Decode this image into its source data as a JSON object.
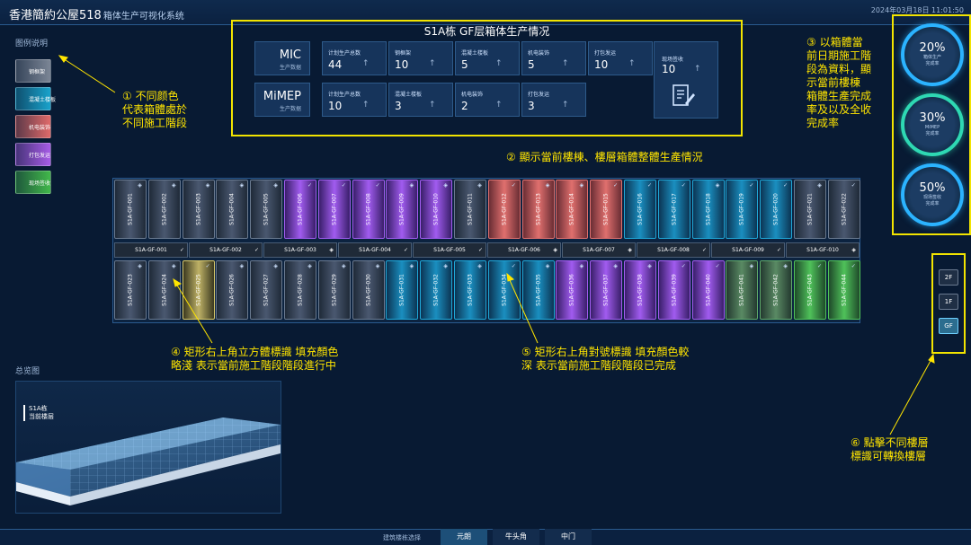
{
  "app": {
    "title": "香港簡約公屋518",
    "subtitle": "箱体生产可视化系统",
    "datetime": "2024年03月18日 11:01:50"
  },
  "legend": {
    "title": "图例说明",
    "items": [
      {
        "label": "钢框架",
        "color": "#7c8696"
      },
      {
        "label": "混凝土楼板",
        "color": "#1aa3cc"
      },
      {
        "label": "机电装饰",
        "color": "#e06a6a"
      },
      {
        "label": "打包发运",
        "color": "#a75ce6"
      },
      {
        "label": "现场签收",
        "color": "#42b84b"
      }
    ]
  },
  "panel": {
    "title": "S1A栋 GF层箱体生产情况",
    "mic": {
      "name": "MIC",
      "sub": "生产数据",
      "stats": [
        {
          "label": "计划生产总数",
          "value": "44"
        },
        {
          "label": "钢框架",
          "value": "10"
        },
        {
          "label": "混凝土楼板",
          "value": "5"
        },
        {
          "label": "机电装饰",
          "value": "5"
        },
        {
          "label": "打包发运",
          "value": "10"
        }
      ]
    },
    "mimep": {
      "name": "MiMEP",
      "sub": "生产数据",
      "stats": [
        {
          "label": "计划生产总数",
          "value": "10"
        },
        {
          "label": "混凝土楼板",
          "value": "3"
        },
        {
          "label": "机电装饰",
          "value": "2"
        },
        {
          "label": "打包发运",
          "value": "3"
        }
      ]
    },
    "signed": {
      "label": "现场签收",
      "value": "10"
    },
    "arrow": "↑"
  },
  "progress": [
    {
      "value": "20%",
      "label1": "箱体生产",
      "label2": "完成率",
      "fraction": 0.2
    },
    {
      "value": "30%",
      "label1": "MiMEP",
      "label2": "完成率",
      "fraction": 0.3
    },
    {
      "value": "50%",
      "label1": "现场签收",
      "label2": "完成率",
      "fraction": 0.5
    }
  ],
  "annotations": {
    "a1": "① 不同颜色\n代表箱體處於\n不同施工階段",
    "a2": "② 顯示當前樓棟、樓層箱體整體生產情況",
    "a3": "③ 以箱體當\n前日期施工階\n段為資料，顯\n示當前樓棟\n箱體生產完成\n率及以及全收\n完成率",
    "a4": "④ 矩形右上角立方體標識  填充顏色\n略淺  表示當前施工階段階段進行中",
    "a5": "⑤ 矩形右上角對號標識  填充顏色較\n深  表示當前施工階段階段已完成",
    "a6": "⑥ 點擊不同樓層\n標識可轉換樓層"
  },
  "top_row": [
    {
      "code": "S1A-GF-001",
      "s": "gray",
      "m": "cube"
    },
    {
      "code": "S1A-GF-002",
      "s": "gray",
      "m": "cube"
    },
    {
      "code": "S1A-GF-003",
      "s": "gray",
      "m": "cube"
    },
    {
      "code": "S1A-GF-004",
      "s": "gray",
      "m": "cube"
    },
    {
      "code": "S1A-GF-005",
      "s": "gray",
      "m": "cube"
    },
    {
      "code": "S1A-GF-006",
      "s": "purple",
      "m": "check"
    },
    {
      "code": "S1A-GF-007",
      "s": "purple",
      "m": "check"
    },
    {
      "code": "S1A-GF-008",
      "s": "purple",
      "m": "check"
    },
    {
      "code": "S1A-GF-009",
      "s": "purple",
      "m": "cube"
    },
    {
      "code": "S1A-GF-010",
      "s": "purple",
      "m": "cube"
    },
    {
      "code": "S1A-GF-011",
      "s": "gray",
      "m": "cube"
    },
    {
      "code": "S1A-GF-012",
      "s": "red",
      "m": "check"
    },
    {
      "code": "S1A-GF-013",
      "s": "red",
      "m": "cube"
    },
    {
      "code": "S1A-GF-014",
      "s": "red",
      "m": "cube"
    },
    {
      "code": "S1A-GF-015",
      "s": "red",
      "m": "check"
    },
    {
      "code": "S1A-GF-016",
      "s": "teal",
      "m": "check"
    },
    {
      "code": "S1A-GF-017",
      "s": "teal",
      "m": "check"
    },
    {
      "code": "S1A-GF-018",
      "s": "teal",
      "m": "cube"
    },
    {
      "code": "S1A-GF-019",
      "s": "teal",
      "m": "check"
    },
    {
      "code": "S1A-GF-020",
      "s": "teal",
      "m": "check"
    },
    {
      "code": "S1A-GF-021",
      "s": "gray",
      "m": "cube"
    },
    {
      "code": "S1A-GF-022",
      "s": "gray",
      "m": "check"
    }
  ],
  "mid_row": [
    {
      "code": "S1A-GF-001",
      "m": "check"
    },
    {
      "code": "S1A-GF-002",
      "m": "check"
    },
    {
      "code": "S1A-GF-003",
      "m": "cube"
    },
    {
      "code": "S1A-GF-004",
      "m": "check"
    },
    {
      "code": "S1A-GF-005",
      "m": "check"
    },
    {
      "code": "S1A-GF-006",
      "m": "cube"
    },
    {
      "code": "S1A-GF-007",
      "m": "cube"
    },
    {
      "code": "S1A-GF-008",
      "m": "check"
    },
    {
      "code": "S1A-GF-009",
      "m": "check"
    },
    {
      "code": "S1A-GF-010",
      "m": "cube"
    }
  ],
  "bottom_row": [
    {
      "code": "S1A-GF-023",
      "s": "gray",
      "m": "cube"
    },
    {
      "code": "S1A-GF-024",
      "s": "gray",
      "m": "cube"
    },
    {
      "code": "S1A-GF-025",
      "s": "yellow",
      "m": "check"
    },
    {
      "code": "S1A-GF-026",
      "s": "gray",
      "m": "cube"
    },
    {
      "code": "S1A-GF-027",
      "s": "gray",
      "m": "cube"
    },
    {
      "code": "S1A-GF-028",
      "s": "gray",
      "m": "cube"
    },
    {
      "code": "S1A-GF-029",
      "s": "gray",
      "m": "cube"
    },
    {
      "code": "S1A-GF-030",
      "s": "gray",
      "m": "cube"
    },
    {
      "code": "S1A-GF-031",
      "s": "teal",
      "m": "cube"
    },
    {
      "code": "S1A-GF-032",
      "s": "teal",
      "m": "cube"
    },
    {
      "code": "S1A-GF-033",
      "s": "teal",
      "m": "cube"
    },
    {
      "code": "S1A-GF-034",
      "s": "teal",
      "m": "check"
    },
    {
      "code": "S1A-GF-035",
      "s": "teal",
      "m": "cube"
    },
    {
      "code": "S1A-GF-036",
      "s": "purple",
      "m": "cube"
    },
    {
      "code": "S1A-GF-037",
      "s": "purple",
      "m": "cube"
    },
    {
      "code": "S1A-GF-038",
      "s": "purple",
      "m": "cube"
    },
    {
      "code": "S1A-GF-039",
      "s": "purple",
      "m": "check"
    },
    {
      "code": "S1A-GF-040",
      "s": "purple",
      "m": "check"
    },
    {
      "code": "S1A-GF-041",
      "s": "light-green",
      "m": "cube"
    },
    {
      "code": "S1A-GF-042",
      "s": "light-green",
      "m": "cube"
    },
    {
      "code": "S1A-GF-043",
      "s": "green",
      "m": "check"
    },
    {
      "code": "S1A-GF-044",
      "s": "green",
      "m": "check"
    }
  ],
  "overview": {
    "title": "总览图",
    "label1": "S1A栋",
    "label2": "当前楼层"
  },
  "floors": {
    "items": [
      "2F",
      "1F",
      "GF"
    ],
    "active": "GF"
  },
  "bottom_tabs": {
    "label": "建筑楼栋选择",
    "items": [
      "元朗",
      "牛头角",
      "中门"
    ],
    "active": "元朗"
  }
}
